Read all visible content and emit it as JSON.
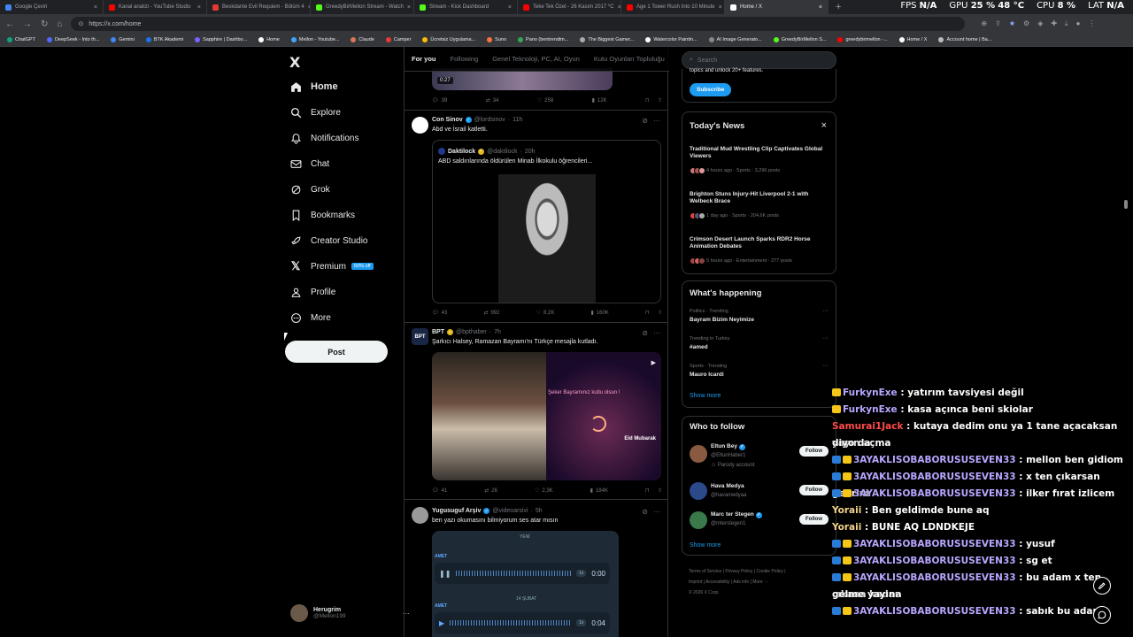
{
  "browser": {
    "tabs": [
      {
        "label": "Google Çeviri",
        "color": "#4285f4"
      },
      {
        "label": "Kanal analizi - YouTube Studio",
        "color": "#ff0000"
      },
      {
        "label": "Beskdante Evil Requiem - Bölüm 4",
        "color": "#e53935"
      },
      {
        "label": "GreedyBirMellon Stream - Watch",
        "color": "#53fc18"
      },
      {
        "label": "Stream - Kick Dashboard",
        "color": "#53fc18"
      },
      {
        "label": "Teke Tek Özel - 26 Kasım 2017 *C",
        "color": "#ff0000"
      },
      {
        "label": "Age 1 Tower Rush Into 10 Minute",
        "color": "#ff0000"
      },
      {
        "label": "Home / X",
        "color": "#ffffff"
      }
    ],
    "new_tab": "+",
    "url": "https://x.com/home",
    "hud": {
      "fps_label": "FPS",
      "fps": "N/A",
      "gpu_label": "GPU",
      "gpu": "25 %",
      "gpu_temp": "48 °C",
      "cpu_label": "CPU",
      "cpu": "8 %",
      "lat_label": "LAT",
      "lat": "N/A"
    },
    "bookmarks": [
      "ChatGPT",
      "DeepSeek - Into th...",
      "Gemini",
      "BTK Akademi",
      "Sapphire | Dashbo...",
      "Home",
      "Mellon - Youtube...",
      "Claude",
      "Camper",
      "Ücretsiz Uygulama...",
      "Suno",
      "Pano (bentrendim...",
      "The Biggest Gamer...",
      "Watercolor Paintin...",
      "AI Image Generato...",
      "GreedyBirMellon S...",
      "greedybirmellon -...",
      "Home / X",
      "Account home | Ba..."
    ]
  },
  "sidebar": {
    "logo": "X",
    "items": [
      "Home",
      "Explore",
      "Notifications",
      "Chat",
      "Grok",
      "Bookmarks",
      "Creator Studio",
      "Premium",
      "Profile",
      "More"
    ],
    "premium_badge": "50% off",
    "post": "Post",
    "user": {
      "name": "Herugrim",
      "handle": "@Mellon199",
      "more": "···"
    }
  },
  "feed": {
    "tabs": [
      "For you",
      "Following",
      "Genel Teknoloji, PC, AI, Oyun",
      "Kutu Oyunları Topluluğu"
    ],
    "top_stats": {
      "duration": "0:27",
      "replies": "39",
      "reposts": "34",
      "likes": "258",
      "views": "12K"
    },
    "posts": [
      {
        "name": "Con Sinov",
        "handle": "@lordsinov",
        "time": "11h",
        "text": "Abd ve İsrail katletti.",
        "quote": {
          "name": "Daktilock",
          "handle": "@daktilock",
          "time": "20h",
          "text": "ABD saldırılarında öldürülen Minab İlkokulu öğrencileri..."
        },
        "stats": {
          "replies": "43",
          "reposts": "992",
          "likes": "8,2K",
          "views": "160K"
        }
      },
      {
        "name": "BPT",
        "handle": "@bpthaber",
        "time": "7h",
        "text": "Şarkıcı Halsey, Ramazan Bayramı'nı Türkçe mesajla kutladı.",
        "media": {
          "caption": "Şeker Bayramınız kutlu olsun !",
          "sub": "Eid Mubarak"
        },
        "stats": {
          "replies": "41",
          "reposts": "26",
          "likes": "2,3K",
          "views": "184K"
        }
      },
      {
        "name": "Yugusuguf Arşiv",
        "handle": "@videoarsivi",
        "time": "5h",
        "text": "ben yazı okumasını bilmiyorum ses atar mısın",
        "audio": {
          "label1": "AMET",
          "day1": "YENİ",
          "label2": "AMET",
          "day2": "14 ŞUBAT",
          "t1": "0:00",
          "t2": "0:04",
          "speed": "1x"
        }
      }
    ]
  },
  "right": {
    "search": "Search",
    "premium_tail": "topics and unlock 20+ features.",
    "subscribe": "Subscribe",
    "news": {
      "title": "Today's News",
      "close": "×",
      "items": [
        {
          "headline": "Traditional Mud Wrestling Clip Captivates Global Viewers",
          "meta": "4 hours ago · Sports · 3,296 posts"
        },
        {
          "headline": "Brighton Stuns Injury-Hit Liverpool 2-1 with Welbeck Brace",
          "meta": "1 day ago · Sports · 204,6K posts"
        },
        {
          "headline": "Crimson Desert Launch Sparks RDR2 Horse Animation Debates",
          "meta": "5 hours ago · Entertainment · 277 posts"
        }
      ]
    },
    "happening": {
      "title": "What's happening",
      "items": [
        {
          "context": "Politics · Trending",
          "name": "Bayram Bizim Neyimize"
        },
        {
          "context": "Trending in Turkey",
          "name": "#amed"
        },
        {
          "context": "Sports · Trending",
          "name": "Mauro Icardi"
        }
      ],
      "show_more": "Show more"
    },
    "follow": {
      "title": "Who to follow",
      "items": [
        {
          "name": "Eltun Bey",
          "handle": "@EltunHaber1",
          "note": "Parody account",
          "button": "Follow"
        },
        {
          "name": "Hava Medya",
          "handle": "@havamedyaa",
          "button": "Follow"
        },
        {
          "name": "Marc ter Stegen",
          "handle": "@mterstegen1",
          "button": "Follow"
        }
      ],
      "show_more": "Show more"
    },
    "footer": [
      "Terms of Service",
      "Privacy Policy",
      "Cookie Policy",
      "Imprint",
      "Accessibility",
      "Ads info",
      "More ···",
      "© 2026 X Corp."
    ]
  },
  "chat": [
    {
      "user": "FurkynExe",
      "msg": " : yatırım tavsiyesi değil",
      "style": "normal"
    },
    {
      "user": "FurkynExe",
      "msg": " : kasa açınca beni skiolar",
      "style": "normal"
    },
    {
      "user": "Samurai1Jack",
      "msg": " : kutaya dedim onu ya 1 tane açacaksan yayın açma",
      "style": "red"
    },
    {
      "user": "",
      "msg": "diyo da",
      "style": "cont"
    },
    {
      "user": "3AYAKLISOBABORUSUSEVEN33",
      "msg": " : mellon ben gidiom",
      "style": "normal"
    },
    {
      "user": "3AYAKLISOBABORUSUSEVEN33",
      "msg": " : x ten çıkarsan gelirim",
      "style": "normal"
    },
    {
      "user": "3AYAKLISOBABORUSUSEVEN33",
      "msg": " : ilker fırat izlicem",
      "style": "normal"
    },
    {
      "user": "Yoraii",
      "msg": " : Ben geldimde bune aq",
      "style": "yellow"
    },
    {
      "user": "Yoraii",
      "msg": " : BUNE AQ LDNDKEJE",
      "style": "yellow"
    },
    {
      "user": "3AYAKLISOBABORUSUSEVEN33",
      "msg": " : yusuf",
      "style": "normal"
    },
    {
      "user": "3AYAKLISOBABORUSUSEVEN33",
      "msg": " : sg et",
      "style": "normal"
    },
    {
      "user": "3AYAKLISOBABORUSUSEVEN33",
      "msg": " : bu adam x ten çıkana kadar",
      "style": "normal"
    },
    {
      "user": "",
      "msg": "gelme yayına",
      "style": "cont"
    },
    {
      "user": "3AYAKLISOBABORUSUSEVEN33",
      "msg": " : sabık bu adam",
      "style": "normal"
    }
  ]
}
